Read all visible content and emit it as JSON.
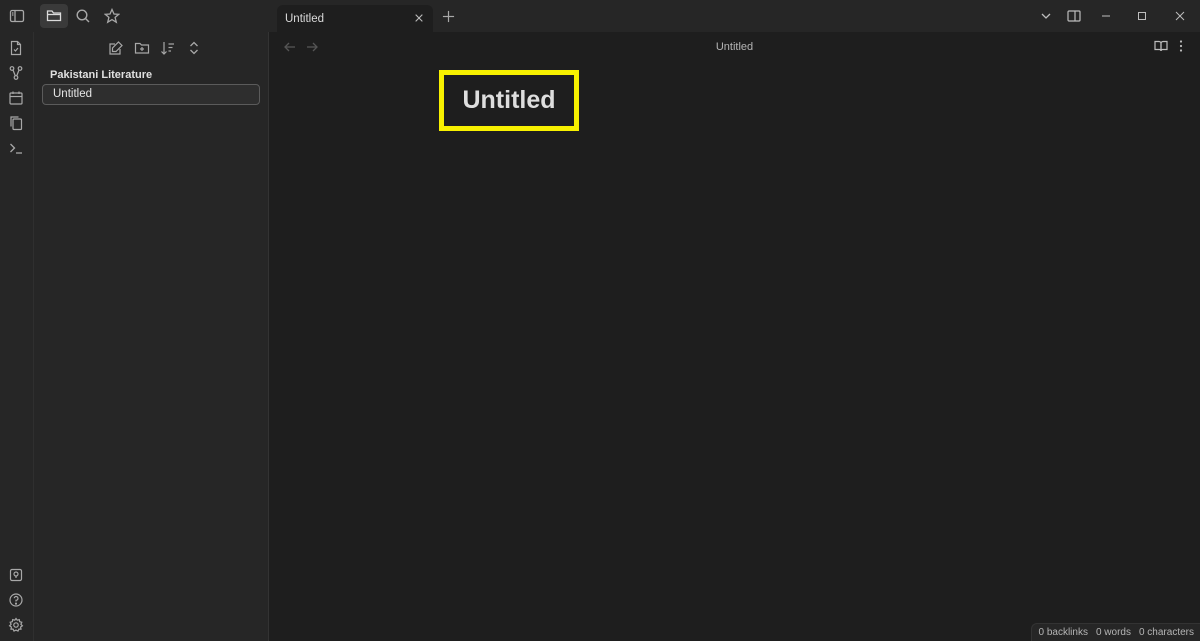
{
  "titlebar": {
    "left_icons": [
      "sidebar-toggle-icon",
      "folder-icon",
      "search-icon",
      "star-icon"
    ],
    "tab": {
      "label": "Untitled"
    },
    "right_icons": [
      "chevron-down-icon",
      "right-sidebar-icon",
      "minimize-icon",
      "maximize-icon",
      "close-icon"
    ]
  },
  "ribbon": {
    "icons": [
      "file-icon",
      "graph-icon",
      "calendar-icon",
      "copy-icon",
      "terminal-icon",
      "vault-icon",
      "help-icon",
      "settings-icon"
    ]
  },
  "explorer": {
    "toolbar_icons": [
      "new-note-icon",
      "new-folder-icon",
      "sort-icon",
      "collapse-icon"
    ],
    "vault_name": "Pakistani Literature",
    "files": [
      "Untitled"
    ]
  },
  "editor": {
    "view_title": "Untitled",
    "note_title": "Untitled"
  },
  "statusbar": {
    "backlinks": "0 backlinks",
    "words": "0 words",
    "characters": "0 characters"
  },
  "colors": {
    "highlight": "#f7f000",
    "background": "#1e1e1e",
    "panel": "#262626"
  }
}
